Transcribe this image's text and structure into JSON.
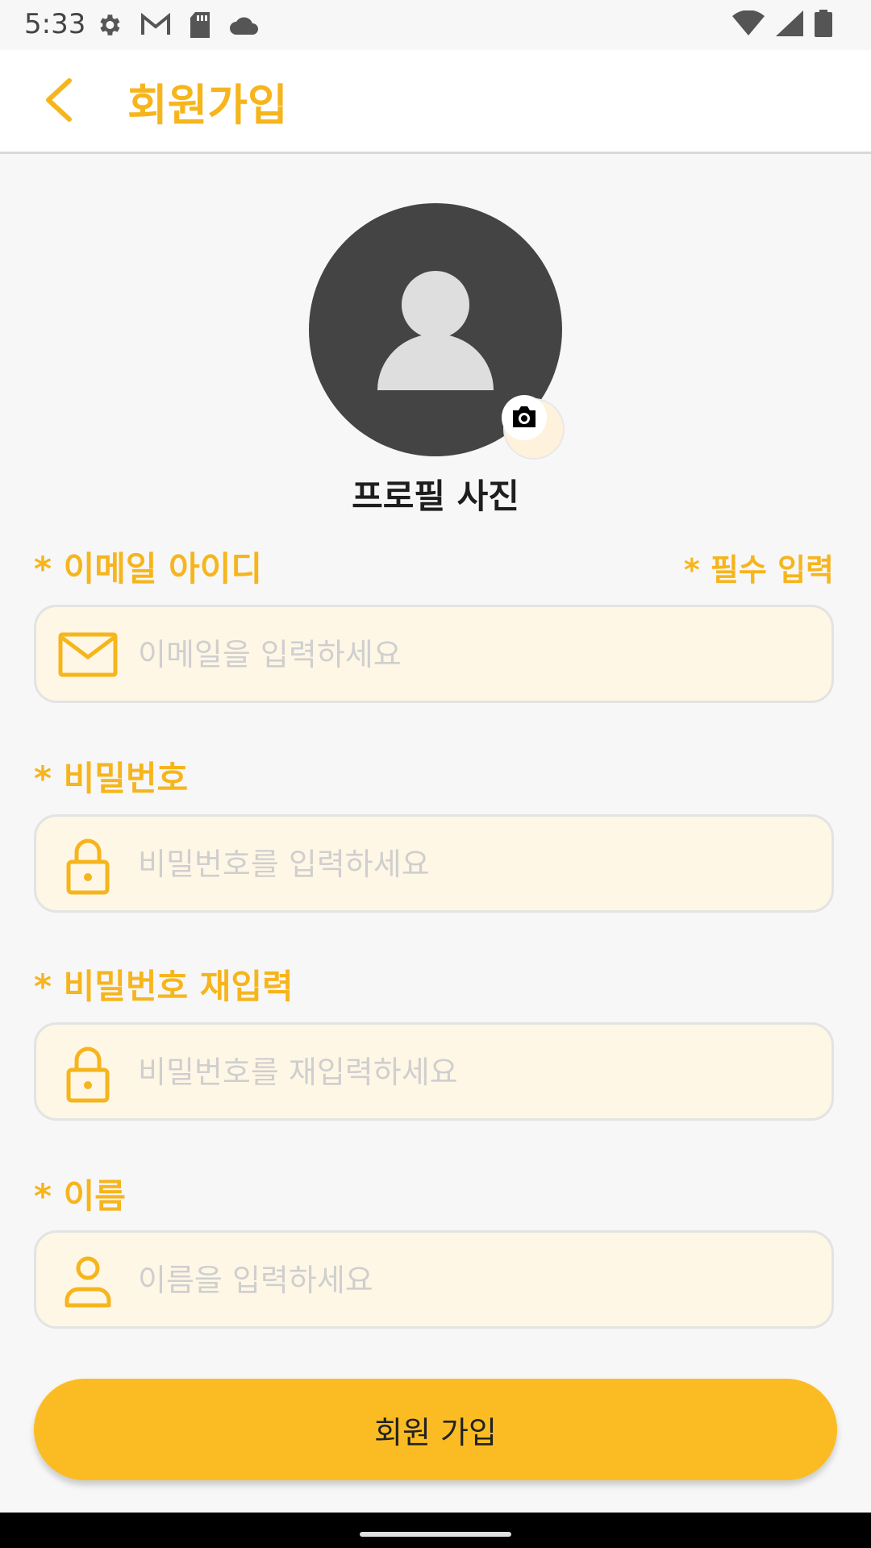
{
  "status_bar": {
    "time": "5:33",
    "left_icons": [
      "settings-icon",
      "gmail-icon",
      "sd-card-icon",
      "cloud-icon"
    ],
    "right_icons": [
      "wifi-icon",
      "signal-icon",
      "battery-icon"
    ]
  },
  "app_bar": {
    "title": "회원가입",
    "back_icon": "chevron-left-icon"
  },
  "profile": {
    "label": "프로필 사진",
    "camera_icon": "camera-icon"
  },
  "form": {
    "required_note": "* 필수 입력",
    "fields": [
      {
        "label": "* 이메일 아이디",
        "placeholder": "이메일을 입력하세요",
        "icon": "mail-icon"
      },
      {
        "label": "* 비밀번호",
        "placeholder": "비밀번호를 입력하세요",
        "icon": "lock-icon"
      },
      {
        "label": "* 비밀번호 재입력",
        "placeholder": "비밀번호를 재입력하세요",
        "icon": "lock-icon"
      },
      {
        "label": "* 이름",
        "placeholder": "이름을 입력하세요",
        "icon": "person-icon"
      }
    ],
    "submit_label": "회원 가입"
  },
  "colors": {
    "accent": "#f6b51d",
    "button": "#fbbc23",
    "input_bg": "#fff7e6",
    "avatar_bg": "#444444"
  }
}
